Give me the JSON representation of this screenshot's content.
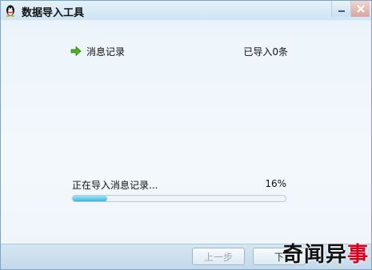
{
  "window": {
    "title": "数据导入工具",
    "controls": {
      "minimize_icon": "minimize-icon",
      "close_icon": "close-icon"
    }
  },
  "step": {
    "icon": "green-arrow-icon",
    "label": "消息记录",
    "count": "已导入0条"
  },
  "status": {
    "text": "正在导入消息记录...",
    "percent_label": "16%",
    "progress": 0.16
  },
  "buttons": {
    "prev": "上一步",
    "next": "下"
  },
  "watermark": {
    "text_main": "奇闻异",
    "text_accent": "事"
  },
  "colors": {
    "accent": "#3fb4dd",
    "title_bar": "#cfe4f3",
    "arrow_green": "#4caf28"
  }
}
